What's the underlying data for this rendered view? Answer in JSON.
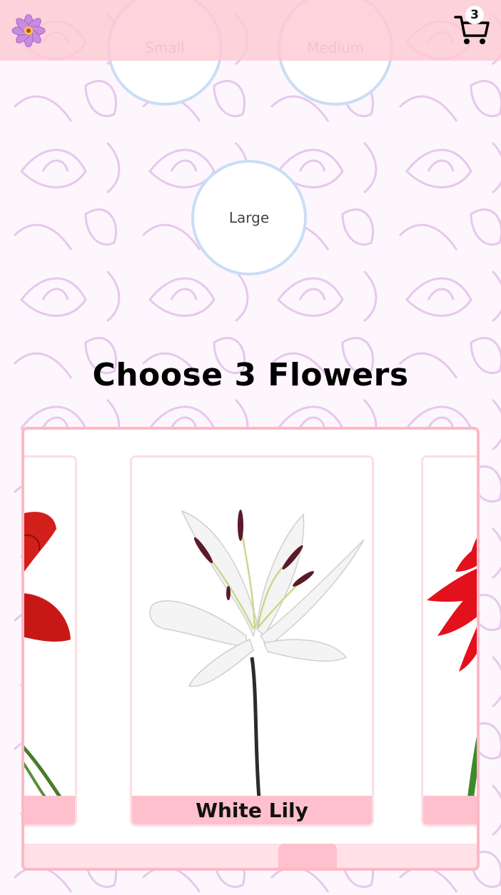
{
  "header": {
    "logo_icon": "flower-logo-icon",
    "cart_icon": "shopping-cart-icon",
    "cart_count": "3"
  },
  "sizes": [
    {
      "label": "Small"
    },
    {
      "label": "Medium"
    },
    {
      "label": "Large"
    }
  ],
  "main": {
    "title": "Choose 3 Flowers"
  },
  "carousel": {
    "cards": [
      {
        "label": "",
        "image": "red-lily-photo"
      },
      {
        "label": "White Lily",
        "image": "white-lily-photo"
      },
      {
        "label": "",
        "image": "red-gerbera-photo"
      }
    ],
    "scroll_fraction": 0.55
  },
  "colors": {
    "header_bg": "#fec9d3",
    "circle_border": "#c9def5",
    "card_label_bg": "#fec0cc",
    "carousel_border": "#fbb9c6"
  }
}
